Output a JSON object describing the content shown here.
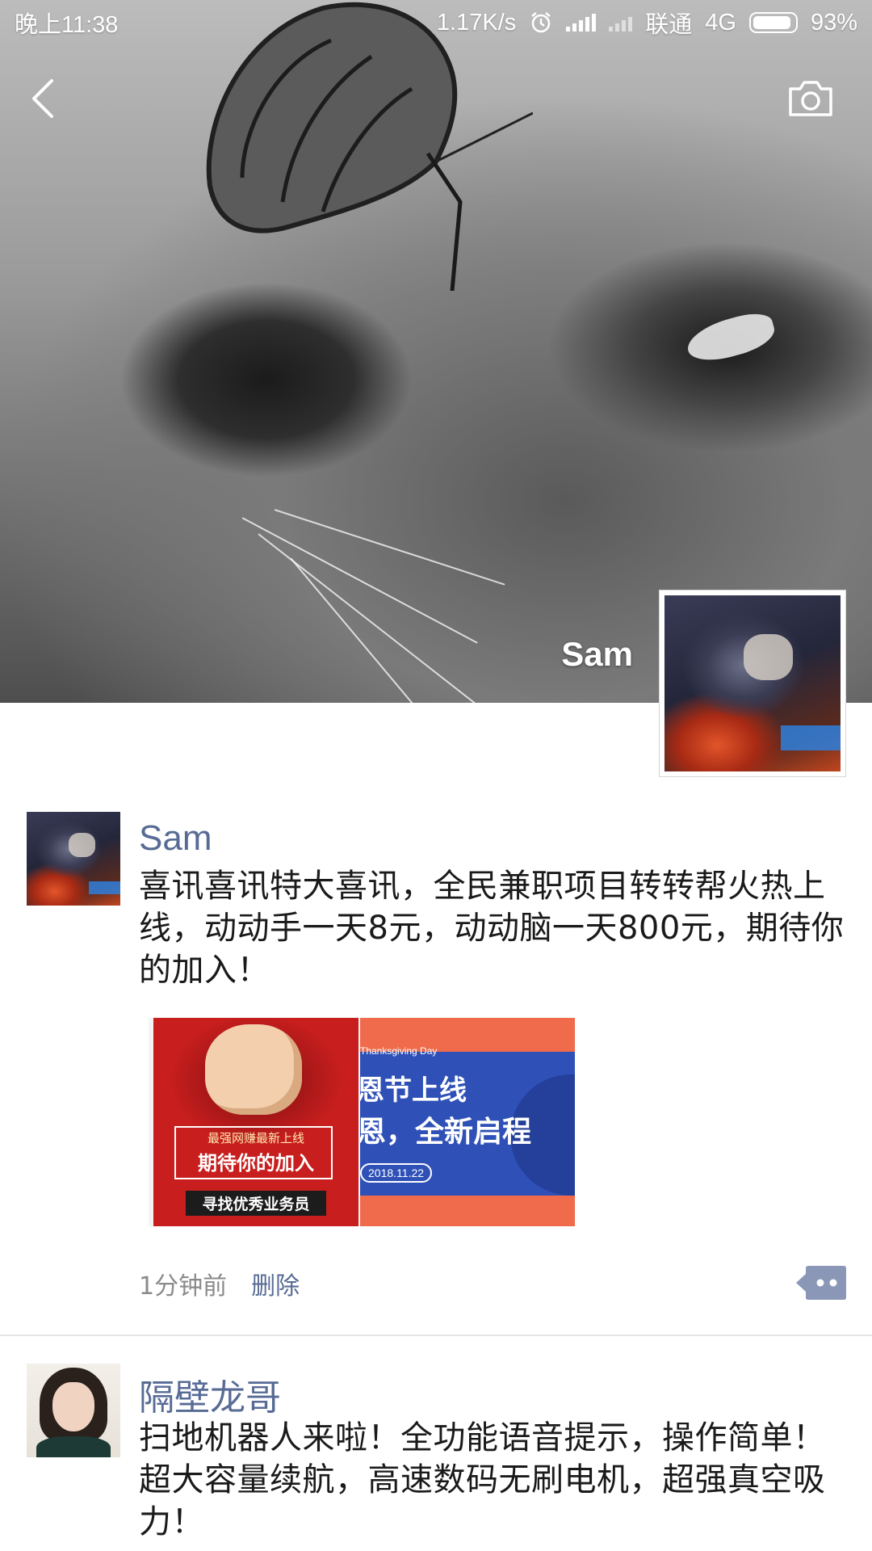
{
  "status_bar": {
    "time": "晚上11:38",
    "net_speed": "1.17K/s",
    "carrier": "联通",
    "network": "4G",
    "battery": "93%",
    "battery_level": 0.93,
    "icons": [
      "alarm-icon",
      "signal-icon",
      "signal-icon",
      "battery-icon"
    ]
  },
  "header": {
    "back_icon": "back-arrow-icon",
    "camera_icon": "camera-icon"
  },
  "cover": {
    "user_name": "Sam"
  },
  "posts": [
    {
      "name": "Sam",
      "text": "喜讯喜讯特大喜讯，全民兼职项目转转帮火热上线，动动手一天8元，动动脑一天800元，期待你的加入！",
      "images": [
        {
          "line1": "最强网赚最新上线",
          "line2": "期待你的加入",
          "line3": "寻找优秀业务员"
        },
        {
          "tag": "Thanksgiving Day",
          "line1": "恩节上线",
          "line2": "恩，全新启程",
          "date": "2018.11.22"
        }
      ],
      "time": "1分钟前",
      "delete_label": "删除"
    },
    {
      "name": "隔壁龙哥",
      "text": "扫地机器人来啦！全功能语音提示，操作简单！超大容量续航，高速数码无刷电机，超强真空吸力！"
    }
  ],
  "colors": {
    "link_blue": "#576b95",
    "text": "#1a1a1a",
    "meta_gray": "#8a8a8a"
  }
}
